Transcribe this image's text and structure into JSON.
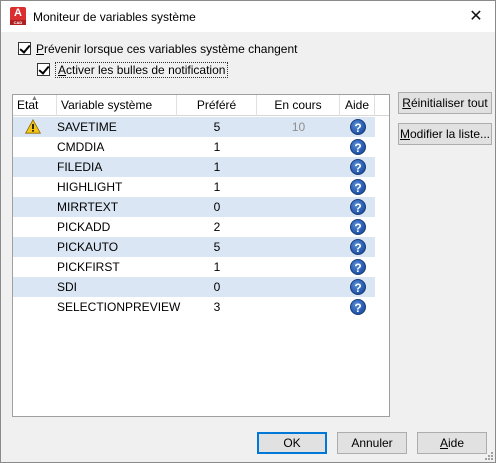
{
  "window": {
    "title": "Moniteur de variables système",
    "app_icon_letter": "A",
    "app_icon_sub": "CAD",
    "close_glyph": "✕"
  },
  "options": {
    "notify_label_first": "P",
    "notify_label_rest": "révenir lorsque ces variables système changent",
    "notify_checked": true,
    "bubbles_label_first": "A",
    "bubbles_label_rest": "ctiver les bulles de notification",
    "bubbles_checked": true
  },
  "grid": {
    "sort_arrow": "▲",
    "columns": {
      "etat": "Etat",
      "variable": "Variable système",
      "prefere": "Préféré",
      "en_cours": "En cours",
      "aide": "Aide"
    },
    "help_glyph": "?",
    "rows": [
      {
        "warning": true,
        "variable": "SAVETIME",
        "prefere": "5",
        "en_cours": "10"
      },
      {
        "warning": false,
        "variable": "CMDDIA",
        "prefere": "1",
        "en_cours": ""
      },
      {
        "warning": false,
        "variable": "FILEDIA",
        "prefere": "1",
        "en_cours": ""
      },
      {
        "warning": false,
        "variable": "HIGHLIGHT",
        "prefere": "1",
        "en_cours": ""
      },
      {
        "warning": false,
        "variable": "MIRRTEXT",
        "prefere": "0",
        "en_cours": ""
      },
      {
        "warning": false,
        "variable": "PICKADD",
        "prefere": "2",
        "en_cours": ""
      },
      {
        "warning": false,
        "variable": "PICKAUTO",
        "prefere": "5",
        "en_cours": ""
      },
      {
        "warning": false,
        "variable": "PICKFIRST",
        "prefere": "1",
        "en_cours": ""
      },
      {
        "warning": false,
        "variable": "SDI",
        "prefere": "0",
        "en_cours": ""
      },
      {
        "warning": false,
        "variable": "SELECTIONPREVIEW",
        "prefere": "3",
        "en_cours": ""
      }
    ]
  },
  "side_buttons": {
    "reset_first": "R",
    "reset_rest": "éinitialiser tout",
    "edit_first": "M",
    "edit_rest": "odifier la liste..."
  },
  "footer": {
    "ok": "OK",
    "cancel": "Annuler",
    "help_first": "A",
    "help_rest": "ide"
  },
  "colors": {
    "row_alt": "#dae6f4",
    "default_button_border": "#0078d7",
    "help_icon": "#2a5fb4",
    "warning": "#f5c518",
    "app_icon": "#d92f2f"
  }
}
